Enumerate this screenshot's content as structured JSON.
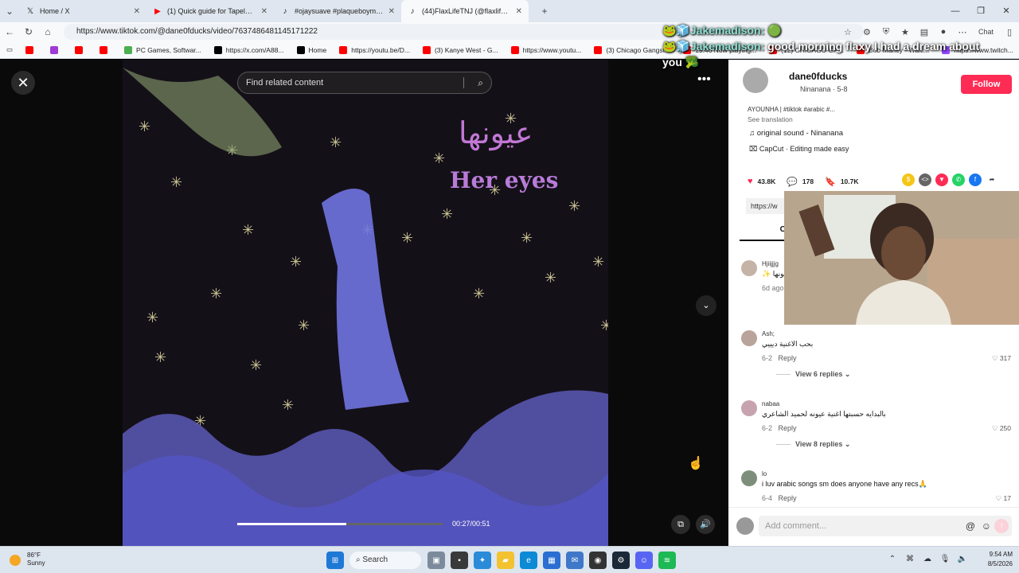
{
  "tabs": [
    {
      "label": "Home / X",
      "favicon": "x-logo-icon"
    },
    {
      "label": "(1) Quick guide for Tapeless Cam",
      "favicon": "youtube-icon"
    },
    {
      "label": "#ojaysuave #plaqueboymaxedit #",
      "favicon": "tiktok-icon"
    },
    {
      "label": "(44)FlaxLifeTNJ (@flaxlifetnj) |",
      "favicon": "tiktok-icon"
    }
  ],
  "address": {
    "url": "https://www.tiktok.com/@dane0fducks/video/7637486481145171222",
    "chat_label": "Chat"
  },
  "bookmarks": [
    {
      "label": "",
      "color": "#ff0000"
    },
    {
      "label": "",
      "color": "#a23bd6"
    },
    {
      "label": "",
      "color": "#ff0000"
    },
    {
      "label": "",
      "color": "#ff0000"
    },
    {
      "label": "PC Games, Softwar...",
      "color": "#4caf50"
    },
    {
      "label": "https://x.com/A88...",
      "color": "#000000"
    },
    {
      "label": "Home",
      "color": "#000000"
    },
    {
      "label": "https://youtu.be/D...",
      "color": "#ff0000"
    },
    {
      "label": "(3) Kanye West - G...",
      "color": "#ff0000"
    },
    {
      "label": "https://www.youtu...",
      "color": "#ff0000"
    },
    {
      "label": "(3) Chicago Gangst...",
      "color": "#ff0000"
    },
    {
      "label": "19:46 Now playing...",
      "color": "#ff0000"
    },
    {
      "label": "(12) CHICAGO GA...",
      "color": "#ff0000"
    },
    {
      "label": "Bob Marley - Waiti...",
      "color": "#ff0000"
    },
    {
      "label": "https://www.twitch...",
      "color": "#9146ff"
    }
  ],
  "video": {
    "search_placeholder": "Find related content",
    "arabic_title": "عيونها",
    "english_title": "Her eyes",
    "time": "00:27/00:51",
    "progress": 0.53
  },
  "chat_overlay": [
    {
      "user": "Jakemadison:",
      "message": "",
      "badges": "🐸🧊",
      "emote": "🟢"
    },
    {
      "user": "Jakemadison:",
      "message": "good morning flaxy I had a dream about you",
      "badges": "🐸🧊",
      "emote": "🥦"
    }
  ],
  "author": {
    "name": "dane0fducks",
    "sub": "Ninanana · 5-8",
    "follow_label": "Follow"
  },
  "post": {
    "description": "AYOUNHA | #tiktok #arabic #...",
    "see_translation": "See translation",
    "sound": "original sound - Ninanana",
    "capcut": "CapCut · Editing made easy",
    "likes": "43.8K",
    "comments": "178",
    "saves": "10.7K",
    "link_prefix": "https://w",
    "comments_tab": "Co"
  },
  "comments": [
    {
      "name": "Hjiijjjg",
      "text": "✨ عيونها",
      "date": "6d ago",
      "likes": "",
      "replies": ""
    },
    {
      "name": "Ash;",
      "text": "بحب الاغنية ديييي",
      "date": "6-2",
      "reply": "Reply",
      "likes": "317",
      "replies": "View 6 replies"
    },
    {
      "name": "nabaa",
      "text": "بالبدايه حسبتها اغنية عيونه لحميد الشاعري",
      "date": "6-2",
      "reply": "Reply",
      "likes": "250",
      "replies": "View 8 replies"
    },
    {
      "name": "lo",
      "text": "i luv arabic songs sm does anyone have any recs🙏",
      "date": "6-4",
      "reply": "Reply",
      "likes": "17",
      "replies": ""
    }
  ],
  "add_comment": {
    "placeholder": "Add comment..."
  },
  "taskbar": {
    "temp": "86°F",
    "condition": "Sunny",
    "search_label": "Search",
    "time": "9:54 AM",
    "date": "8/5/2026"
  },
  "colors": {
    "follow": "#fe2c55",
    "like_heart": "#fe2c55",
    "title_purple": "#c178d6"
  }
}
